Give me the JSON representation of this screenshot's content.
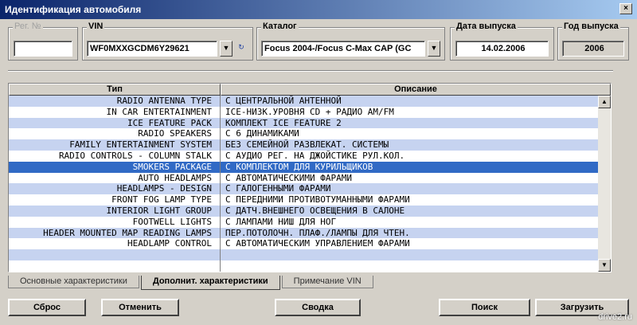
{
  "window": {
    "title": "Идентификация автомобиля",
    "close_glyph": "×"
  },
  "fields": {
    "reg_label": "Рег. №",
    "reg_value": "",
    "vin_label": "VIN",
    "vin_value": "WF0MXXGCDM6Y29621",
    "catalog_label": "Каталог",
    "catalog_value": "Focus 2004-/Focus C-Max CAP (GC",
    "issue_date_label": "Дата выпуска",
    "issue_date_value": "14.02.2006",
    "issue_year_label": "Год выпуска",
    "issue_year_value": "2006"
  },
  "grid": {
    "columns": [
      "Тип",
      "Описание"
    ],
    "selected_index": 6,
    "rows": [
      {
        "type": "RADIO ANTENNA TYPE",
        "desc": "С ЦЕНТРАЛЬНОЙ АНТЕННОЙ"
      },
      {
        "type": "IN CAR ENTERTAINMENT",
        "desc": "ICE-НИЗК.УРОВНЯ CD + РАДИО AM/FM"
      },
      {
        "type": "ICE FEATURE PACK",
        "desc": "КОМПЛЕКТ ICE FEATURE 2"
      },
      {
        "type": "RADIO SPEAKERS",
        "desc": "С 6 ДИНАМИКАМИ"
      },
      {
        "type": "FAMILY ENTERTAINMENT SYSTEM",
        "desc": "БЕЗ СЕМЕЙНОЙ РАЗВЛЕКАТ. СИСТЕМЫ"
      },
      {
        "type": "RADIO CONTROLS - COLUMN STALK",
        "desc": "С АУДИО РЕГ. НА ДЖОЙСТИКЕ РУЛ.КОЛ."
      },
      {
        "type": "SMOKERS PACKAGE",
        "desc": "С КОМПЛЕКТОМ ДЛЯ КУРИЛЬЩИКОВ"
      },
      {
        "type": "AUTO HEADLAMPS",
        "desc": "С АВТОМАТИЧЕСКИМИ ФАРАМИ"
      },
      {
        "type": "HEADLAMPS - DESIGN",
        "desc": "С ГАЛОГЕННЫМИ ФАРАМИ"
      },
      {
        "type": "FRONT FOG LAMP TYPE",
        "desc": "С ПЕРЕДНИМИ ПРОТИВОТУМАННЫМИ ФАРАМИ"
      },
      {
        "type": "INTERIOR LIGHT GROUP",
        "desc": "С ДАТЧ.ВНЕШНЕГО ОСВЕЩЕНИЯ В САЛОНЕ"
      },
      {
        "type": "FOOTWELL LIGHTS",
        "desc": "С ЛАМПАМИ НИШ ДЛЯ НОГ"
      },
      {
        "type": "HEADER MOUNTED MAP READING LAMPS",
        "desc": "ПЕР.ПОТОЛОЧН. ПЛАФ./ЛАМПЫ ДЛЯ ЧТЕН."
      },
      {
        "type": "HEADLAMP CONTROL",
        "desc": "С АВТОМАТИЧЕСКИМ УПРАВЛЕНИЕМ ФАРАМИ"
      },
      {
        "type": "",
        "desc": ""
      },
      {
        "type": "",
        "desc": ""
      }
    ]
  },
  "tabs": [
    "Основные характеристики",
    "Дополнит. характеристики",
    "Примечание VIN"
  ],
  "active_tab": 1,
  "buttons": {
    "reset": "Сброс",
    "cancel": "Отменить",
    "summary": "Сводка",
    "search": "Поиск",
    "load": "Загрузить"
  },
  "watermark": "drive2.ru",
  "colors": {
    "title_start": "#0a246a",
    "title_end": "#a6caf0",
    "row_alt": "#c6d3f0",
    "selected": "#316ac5"
  }
}
